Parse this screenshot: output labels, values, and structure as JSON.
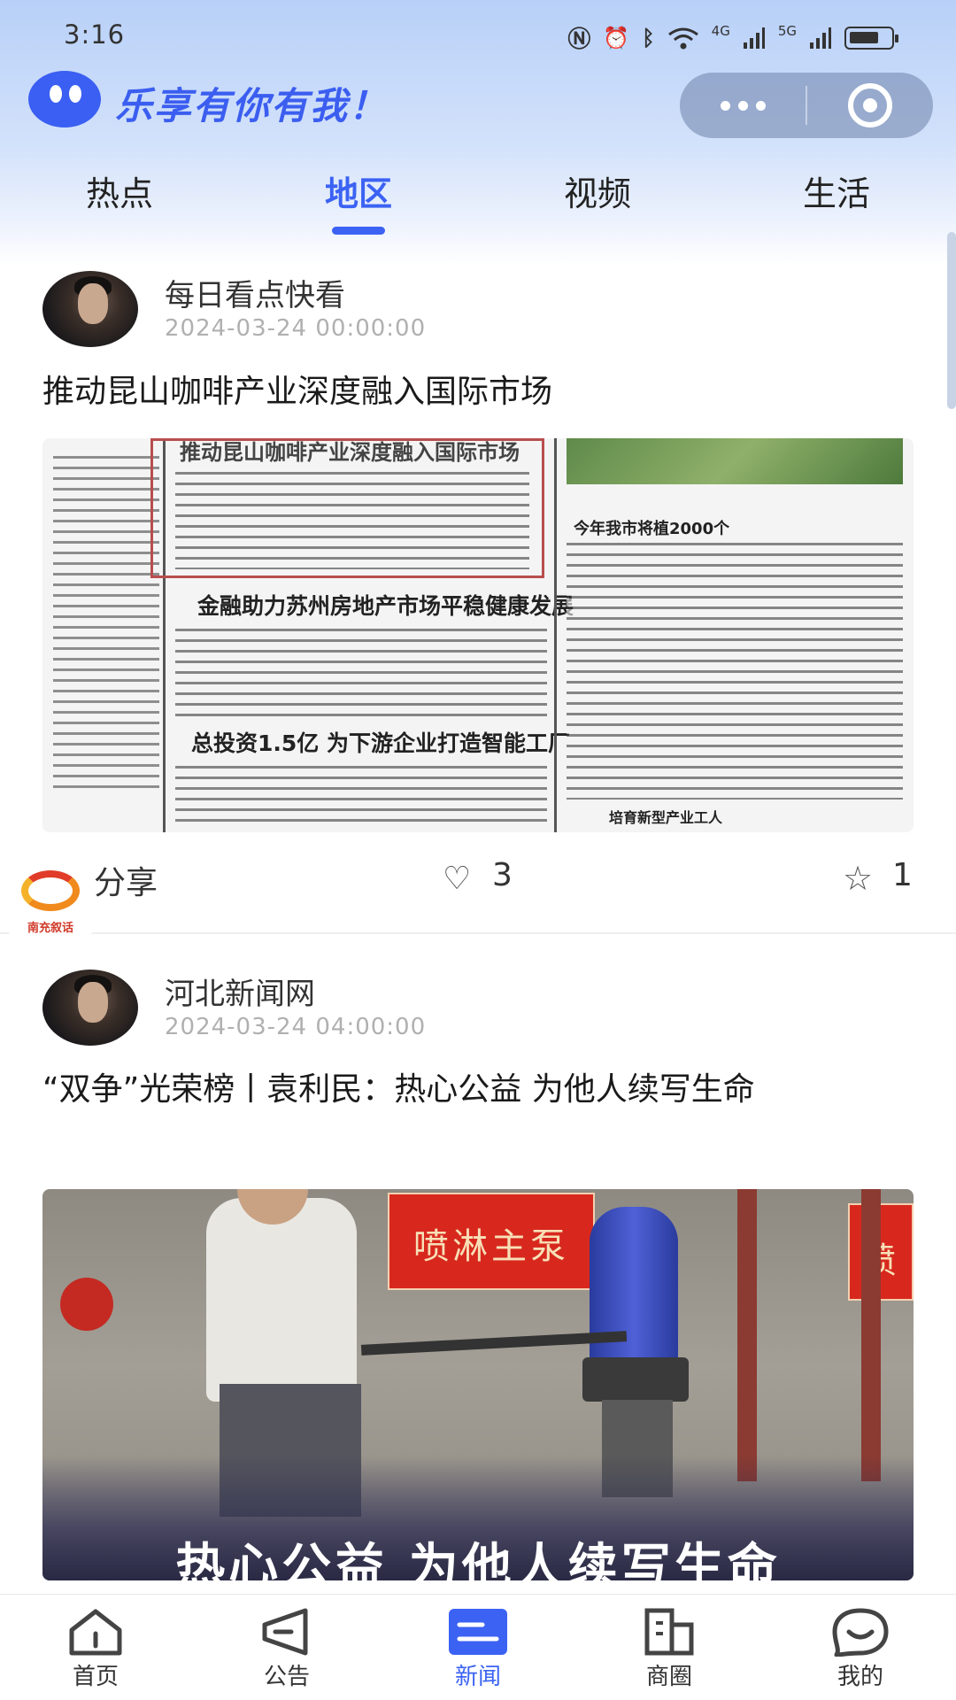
{
  "status_bar": {
    "time": "3:16",
    "network_4g": "4G",
    "network_5g": "5G"
  },
  "header": {
    "title": "乐享有你有我！"
  },
  "tabs": [
    {
      "label": "热点"
    },
    {
      "label": "地区"
    },
    {
      "label": "视频"
    },
    {
      "label": "生活"
    }
  ],
  "active_tab": "地区",
  "feed": [
    {
      "author": "每日看点快看",
      "date": "2024-03-24 00:00:00",
      "headline": "推动昆山咖啡产业深度融入国际市场",
      "image_texts": {
        "banner": "推动昆山咖啡产业深度融入国际市场",
        "head1": "金融助力苏州房地产市场平稳健康发展",
        "head2": "总投资1.5亿 为下游企业打造智能工厂",
        "side_head": "今年我市将植2000个",
        "side_foot": "培育新型产业工人"
      },
      "share_label": "分享",
      "likes": "3",
      "favorites": "1"
    },
    {
      "author": "河北新闻网",
      "date": "2024-03-24 04:00:00",
      "headline": "“双争”光荣榜丨袁利民：热心公益 为他人续写生命",
      "image_texts": {
        "sign": "喷淋主泵",
        "sign2": "喷",
        "caption": "热心公益 为他人续写生命"
      }
    }
  ],
  "floating_badge": {
    "caption": "南充叙话"
  },
  "tabbar": [
    {
      "label": "首页",
      "icon": "home-icon"
    },
    {
      "label": "公告",
      "icon": "announcement-icon"
    },
    {
      "label": "新闻",
      "icon": "news-icon"
    },
    {
      "label": "商圈",
      "icon": "business-icon"
    },
    {
      "label": "我的",
      "icon": "profile-icon"
    }
  ],
  "active_tabbar": "新闻",
  "colors": {
    "accent": "#3b62f3",
    "logo_blue": "#3a5ff2"
  }
}
